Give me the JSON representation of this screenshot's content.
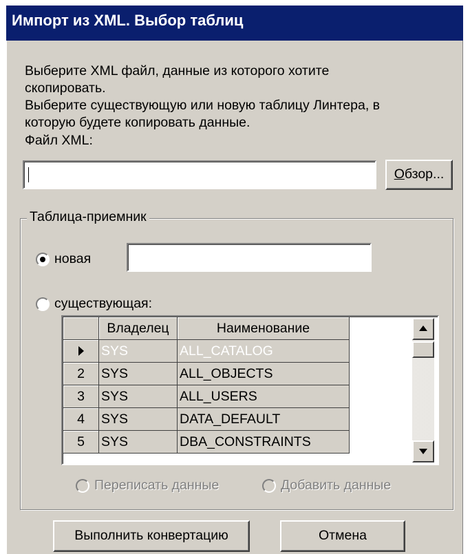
{
  "window": {
    "title": "Импорт из XML. Выбор таблиц"
  },
  "description": {
    "lines": [
      "Выберите XML файл, данные из которого хотите",
      "скопировать.",
      "Выберите существующую или новую таблицу Линтера, в",
      "которую будете копировать данные."
    ]
  },
  "file": {
    "label": "Файл XML:",
    "value": "",
    "browse_button": "Обзор..."
  },
  "target": {
    "group_label": "Таблица-приемник",
    "new_label": "новая",
    "new_value": "",
    "new_selected": true,
    "existing_label": "существующая:",
    "existing_selected": false
  },
  "grid": {
    "columns": [
      "Владелец",
      "Наименование"
    ],
    "rows": [
      {
        "indicator": "",
        "owner": "SYS",
        "name": "ALL_CATALOG",
        "current": true
      },
      {
        "indicator": "2",
        "owner": "SYS",
        "name": "ALL_OBJECTS",
        "current": false
      },
      {
        "indicator": "3",
        "owner": "SYS",
        "name": "ALL_USERS",
        "current": false
      },
      {
        "indicator": "4",
        "owner": "SYS",
        "name": "DATA_DEFAULT",
        "current": false
      },
      {
        "indicator": "5",
        "owner": "SYS",
        "name": "DBA_CONSTRAINTS",
        "current": false
      }
    ]
  },
  "mode": {
    "overwrite_label": "Переписать данные",
    "append_label": "Добавить данные",
    "disabled": true
  },
  "buttons": {
    "convert": "Выполнить конвертацию",
    "cancel": "Отмена"
  },
  "colors": {
    "titlebar": "#0a1f6e",
    "face": "#d4d0c8",
    "disabled_text": "#808080"
  }
}
